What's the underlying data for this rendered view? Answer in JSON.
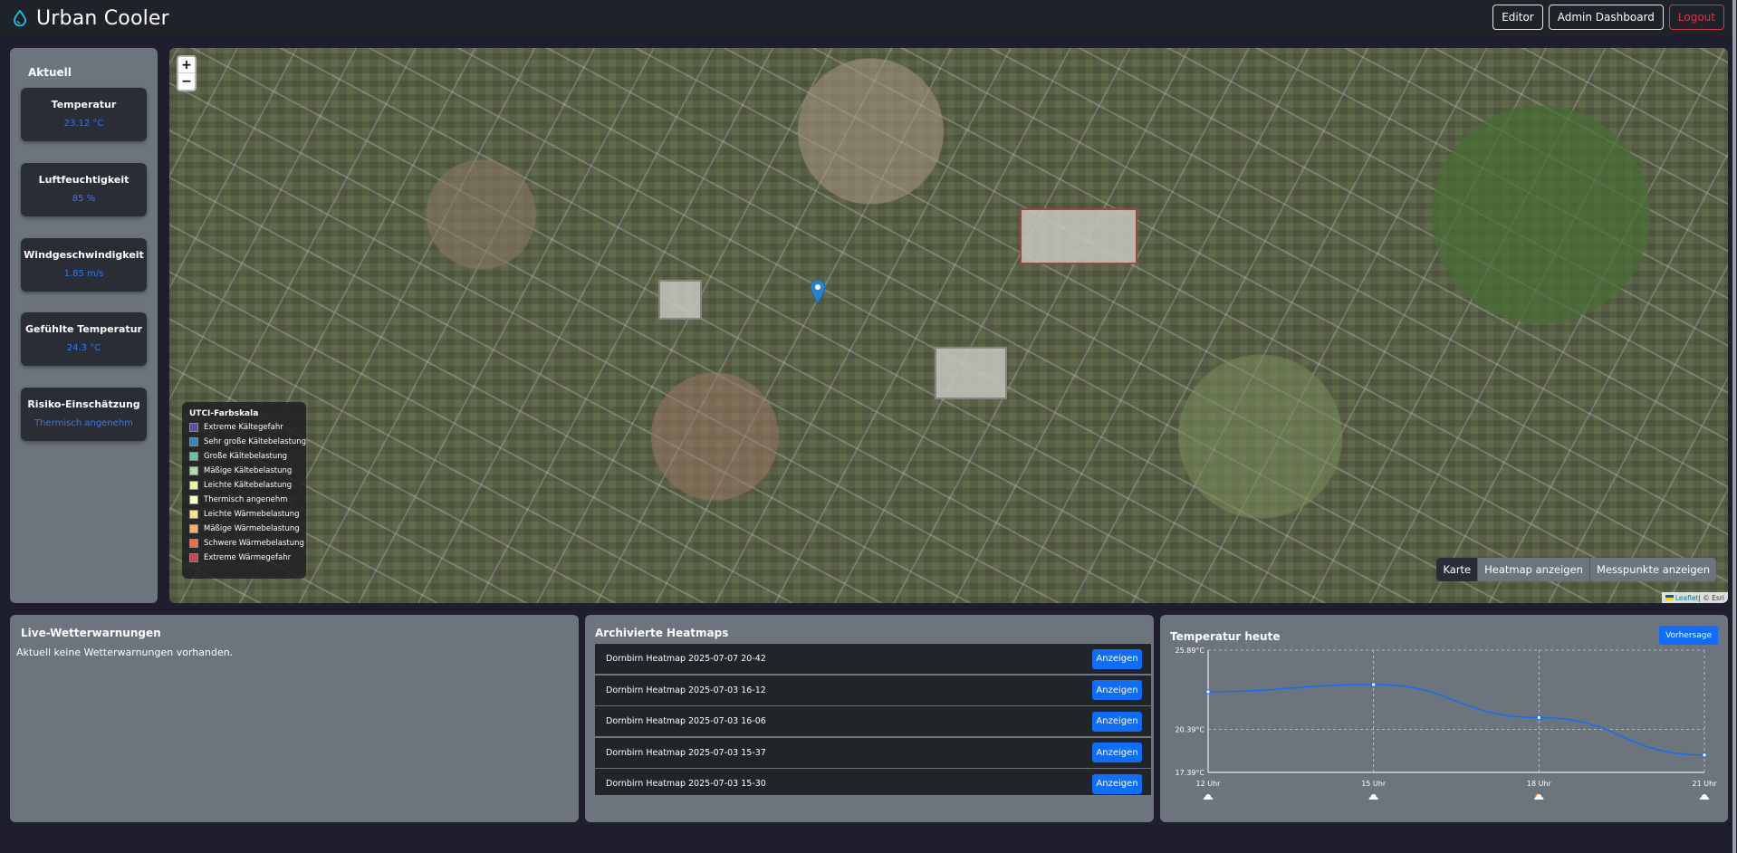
{
  "header": {
    "title": "Urban Cooler",
    "buttons": {
      "editor": "Editor",
      "admin": "Admin Dashboard",
      "logout": "Logout"
    }
  },
  "sidebar": {
    "title": "Aktuell",
    "metrics": [
      {
        "label": "Temperatur",
        "value": "23.12 °C"
      },
      {
        "label": "Luftfeuchtigkeit",
        "value": "85 %"
      },
      {
        "label": "Windgeschwindigkeit",
        "value": "1.85 m/s"
      },
      {
        "label": "Gefühlte Temperatur",
        "value": "24.3 °C"
      },
      {
        "label": "Risiko-Einschätzung",
        "value": "Thermisch angenehm"
      }
    ]
  },
  "map": {
    "zoom_in": "+",
    "zoom_out": "−",
    "legend": {
      "title": "UTCI-Farbskala",
      "items": [
        {
          "label": "Extreme Kältegefahr",
          "color": "#5e4fa2"
        },
        {
          "label": "Sehr große Kältebelastung",
          "color": "#3288bd"
        },
        {
          "label": "Große Kältebelastung",
          "color": "#66c2a5"
        },
        {
          "label": "Mäßige Kältebelastung",
          "color": "#abdda4"
        },
        {
          "label": "Leichte Kältebelastung",
          "color": "#e6f598"
        },
        {
          "label": "Thermisch angenehm",
          "color": "#ffffbf"
        },
        {
          "label": "Leichte Wärmebelastung",
          "color": "#fee08b"
        },
        {
          "label": "Mäßige Wärmebelastung",
          "color": "#fdae61"
        },
        {
          "label": "Schwere Wärmebelastung",
          "color": "#f46d43"
        },
        {
          "label": "Extreme Wärmegefahr",
          "color": "#d53e4f"
        }
      ]
    },
    "layers": {
      "karte": "Karte",
      "heatmap": "Heatmap anzeigen",
      "messpunkte": "Messpunkte anzeigen"
    },
    "attribution": {
      "leaflet": "Leaflet",
      "sep": " | © Esri"
    }
  },
  "warnings": {
    "title": "Live-Wetterwarnungen",
    "text": "Aktuell keine Wetterwarnungen vorhanden."
  },
  "archive": {
    "title": "Archivierte Heatmaps",
    "button_label": "Anzeigen",
    "items": [
      "Dornbirn Heatmap 2025-07-07 20-42",
      "Dornbirn Heatmap 2025-07-03 16-12",
      "Dornbirn Heatmap 2025-07-03 16-06",
      "Dornbirn Heatmap 2025-07-03 15-37",
      "Dornbirn Heatmap 2025-07-03 15-30"
    ]
  },
  "temperature": {
    "title": "Temperatur heute",
    "forecast_button": "Vorhersage"
  },
  "chart_data": {
    "type": "line",
    "x": [
      "12 Uhr",
      "15 Uhr",
      "18 Uhr",
      "21 Uhr"
    ],
    "series": [
      {
        "values": [
          23.0,
          23.5,
          21.2,
          18.6
        ]
      }
    ],
    "ytick_labels": [
      "25.89°C",
      "20.39°C",
      "17.39°C"
    ],
    "yticks": [
      25.89,
      20.39,
      17.39
    ],
    "ylim": [
      17.39,
      25.89
    ],
    "grid": true,
    "line_color": "#0d6efd",
    "weather_icons": [
      "cloud-icon",
      "cloud-icon",
      "cloud-sun-icon",
      "cloud-icon"
    ]
  }
}
